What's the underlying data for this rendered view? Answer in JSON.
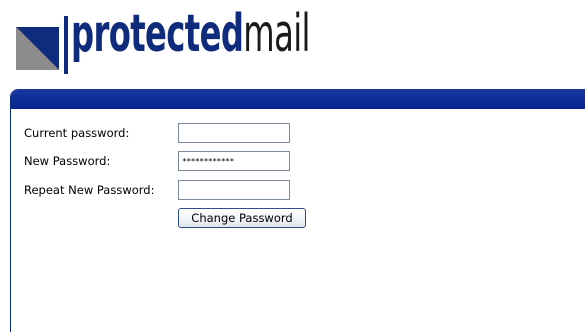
{
  "logo": {
    "text_bold": "protected",
    "text_light": "mail"
  },
  "form": {
    "current_password": {
      "label": "Current password:",
      "value": ""
    },
    "new_password": {
      "label": "New Password:",
      "value": "************"
    },
    "repeat_new_password": {
      "label": "Repeat New Password:",
      "value": ""
    },
    "submit_label": "Change Password"
  },
  "colors": {
    "brand_navy": "#0e2b7c",
    "header_bar": "#06238c",
    "logo_triangle_gray": "#8c8c8c"
  }
}
